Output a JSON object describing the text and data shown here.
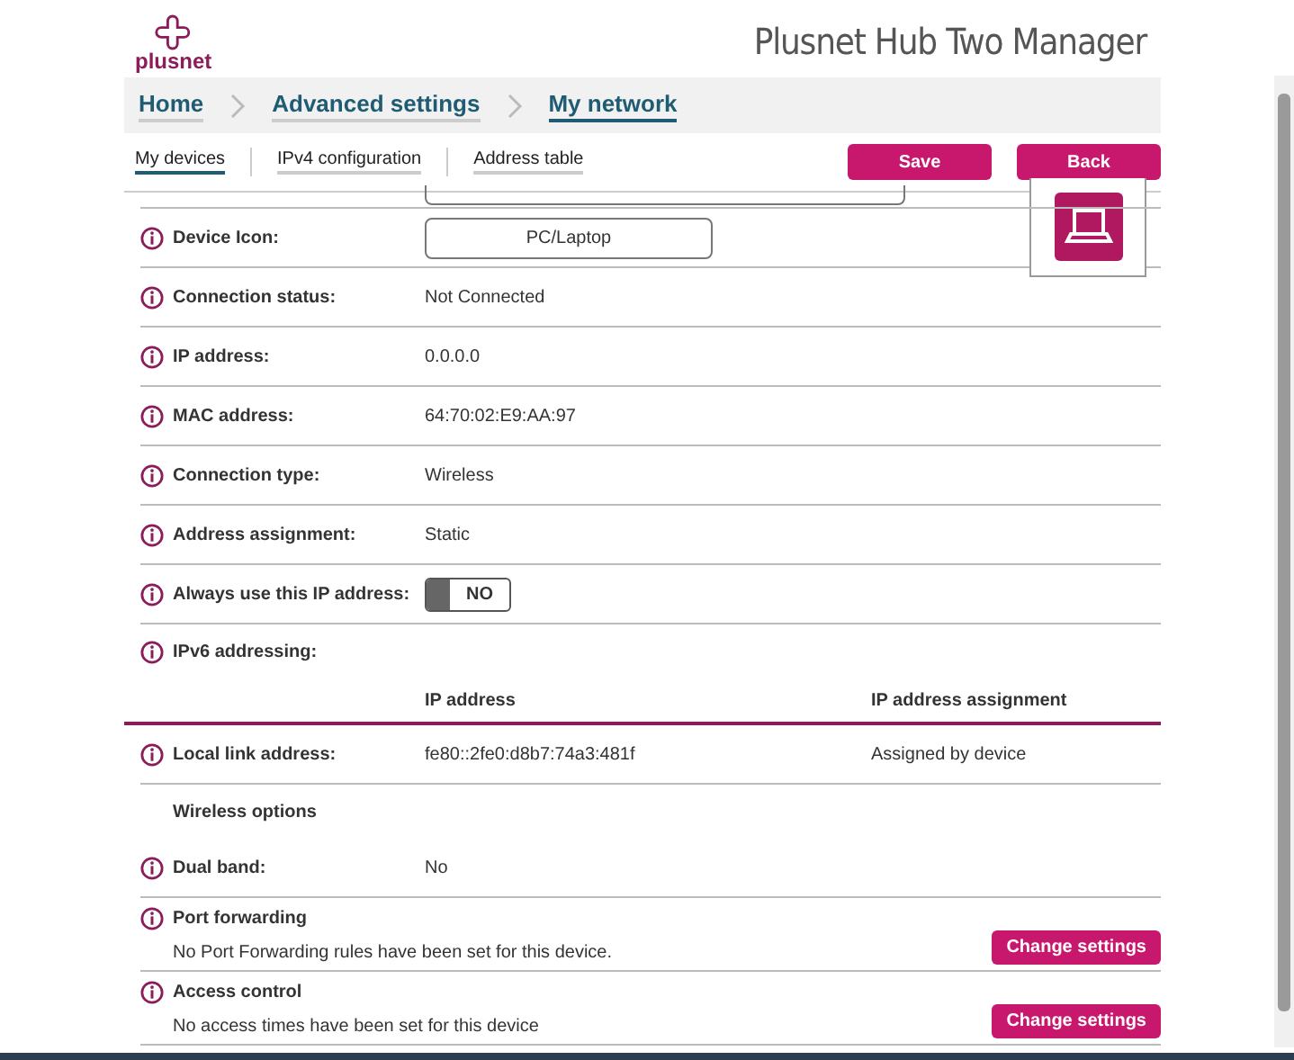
{
  "header": {
    "logo": "plusnet",
    "title": "Plusnet Hub Two Manager"
  },
  "breadcrumbs": [
    {
      "label": "Home",
      "selected": false
    },
    {
      "label": "Advanced settings",
      "selected": false
    },
    {
      "label": "My network",
      "selected": true
    }
  ],
  "tabs": [
    {
      "label": "My devices",
      "selected": true
    },
    {
      "label": "IPv4 configuration",
      "selected": false
    },
    {
      "label": "Address table",
      "selected": false
    }
  ],
  "buttons": [
    "Save",
    "Back"
  ],
  "rows": [
    {
      "kind": "field",
      "label": "Device Icon:",
      "value": "PC/Laptop"
    },
    {
      "kind": "text",
      "label": "Connection status:",
      "value": "Not Connected"
    },
    {
      "kind": "text",
      "label": "IP address:",
      "value": "0.0.0.0"
    },
    {
      "kind": "text",
      "label": "MAC address:",
      "value": "64:70:02:E9:AA:97"
    },
    {
      "kind": "text",
      "label": "Connection type:",
      "value": "Wireless"
    },
    {
      "kind": "text",
      "label": "Address assignment:",
      "value": "Static"
    },
    {
      "kind": "toggle",
      "label": "Always use this IP address:",
      "value": "NO",
      "on": false
    },
    {
      "kind": "heading",
      "label": "IPv6 addressing:"
    },
    {
      "kind": "columns",
      "value": "IP address",
      "extra": "IP address assignment"
    },
    {
      "kind": "text",
      "label": "Local link address:",
      "value": "fe80::2fe0:d8b7:74a3:481f",
      "extra": "Assigned by device"
    },
    {
      "kind": "subheading",
      "label": "Wireless options"
    },
    {
      "kind": "text",
      "label": "Dual band:",
      "value": "No"
    },
    {
      "kind": "action",
      "label": "Port forwarding",
      "note": "No Port Forwarding rules have been set for this device.",
      "button": "Change settings"
    },
    {
      "kind": "action",
      "label": "Access control",
      "note": "No access times have been set for this device",
      "button": "Change settings"
    }
  ]
}
